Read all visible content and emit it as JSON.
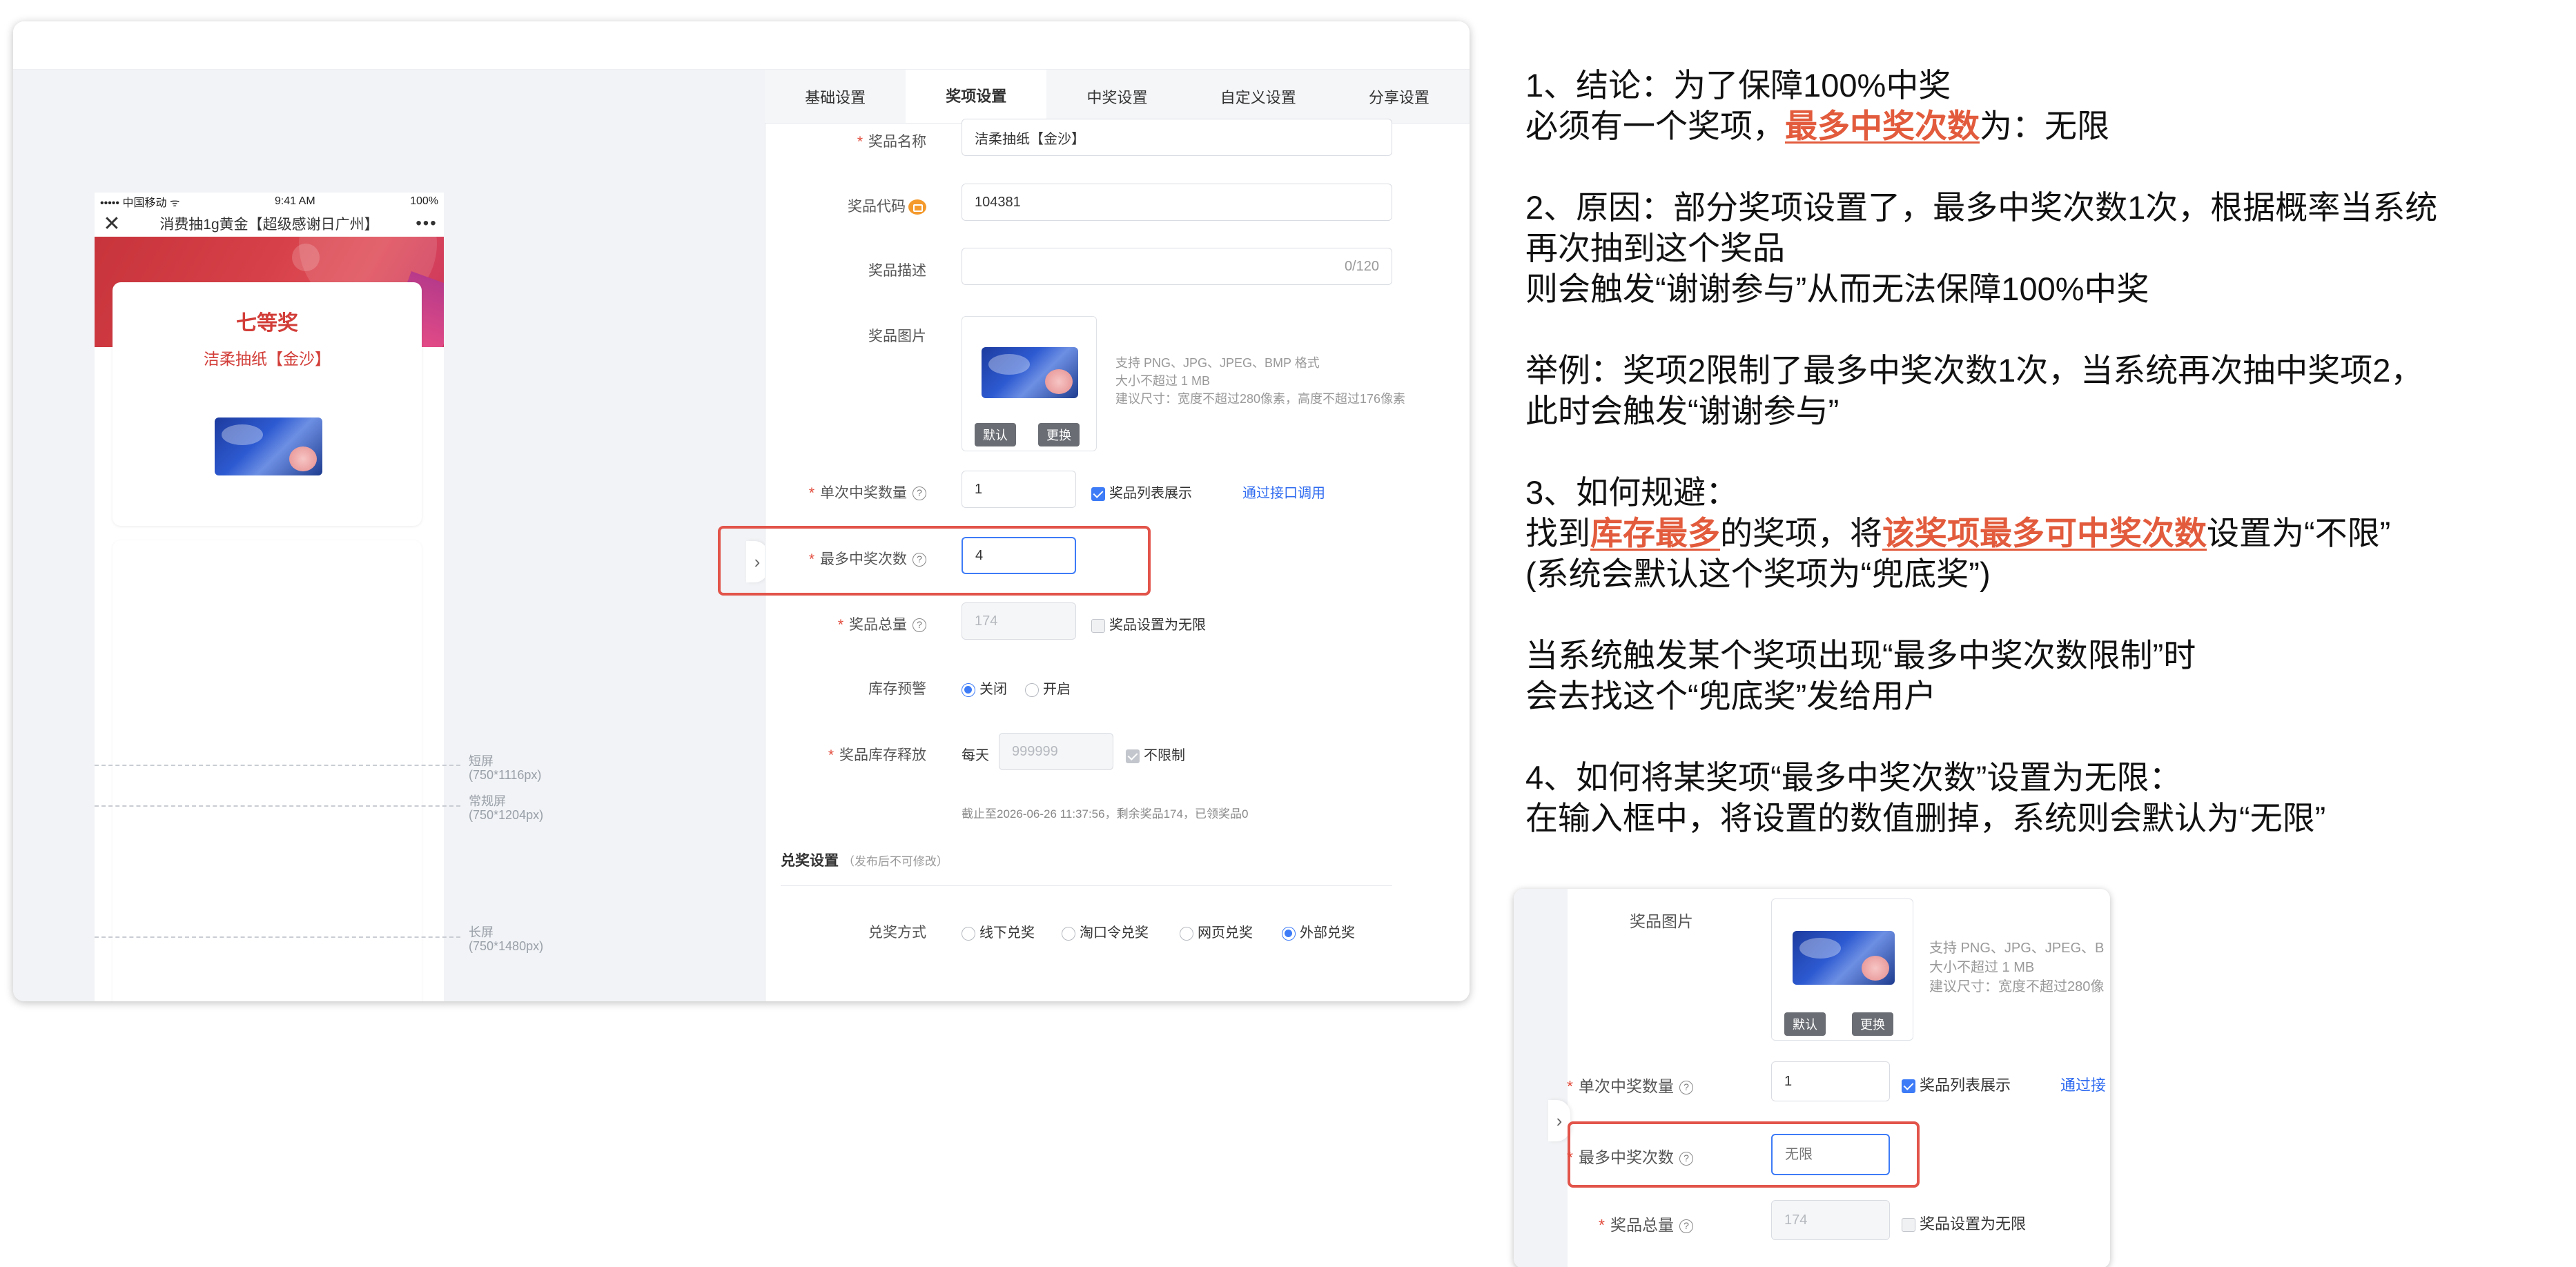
{
  "tabs": [
    "基础设置",
    "奖项设置",
    "中奖设置",
    "自定义设置",
    "分享设置"
  ],
  "phone": {
    "carrier": "••••• 中国移动 ᯤ",
    "time": "9:41 AM",
    "battery": "100%",
    "title": "消费抽1g黄金【超级感谢日广州】",
    "close": "✕",
    "more": "•••",
    "prize_level": "七等奖",
    "prize_name": "洁柔抽纸【金沙】"
  },
  "guides": [
    {
      "label": "短屏",
      "size": "(750*1116px)"
    },
    {
      "label": "常规屏",
      "size": "(750*1204px)"
    },
    {
      "label": "长屏",
      "size": "(750*1480px)"
    }
  ],
  "form": {
    "name_label": "奖品名称",
    "name_value": "洁柔抽纸【金沙】",
    "code_label": "奖品代码",
    "code_value": "104381",
    "desc_label": "奖品描述",
    "desc_count": "0/120",
    "image_label": "奖品图片",
    "image_hint_1": "支持 PNG、JPG、JPEG、BMP 格式",
    "image_hint_2": "大小不超过 1 MB",
    "image_hint_3": "建议尺寸：宽度不超过280像素，高度不超过176像素",
    "btn_default": "默认",
    "btn_replace": "更换",
    "single_label": "单次中奖数量",
    "single_value": "1",
    "show_in_list": "奖品列表展示",
    "api_link": "通过接口调用",
    "max_label": "最多中奖次数",
    "max_value": "4",
    "total_label": "奖品总量",
    "total_value": "174",
    "total_unlimited": "奖品设置为无限",
    "alert_label": "库存预警",
    "alert_off": "关闭",
    "alert_on": "开启",
    "release_label": "奖品库存释放",
    "release_daily": "每天",
    "release_value": "999999",
    "release_unlimited": "不限制",
    "stock_note": "截止至2026-06-26 11:37:56，剩余奖品174，已领奖品0",
    "redeem_section": "兑奖设置",
    "redeem_note": "（发布后不可修改）",
    "redeem_label": "兑奖方式",
    "redeem_options": [
      "线下兑奖",
      "淘口令兑奖",
      "网页兑奖",
      "外部兑奖"
    ]
  },
  "notes": {
    "p1_l1": "1、结论：为了保障100%中奖",
    "p1_l2_a": "必须有一个奖项，",
    "p1_l2_hl": "最多中奖次数",
    "p1_l2_b": "为：无限",
    "p2_l1": "2、原因：部分奖项设置了，最多中奖次数1次，根据概率当系统",
    "p2_l2": "再次抽到这个奖品",
    "p2_l3": "则会触发“谢谢参与”从而无法保障100%中奖",
    "p3_l1": "举例：奖项2限制了最多中奖次数1次，当系统再次抽中奖项2，",
    "p3_l2": "此时会触发“谢谢参与”",
    "p4_l1": "3、如何规避：",
    "p4_l2_a": "找到",
    "p4_l2_hl1": "库存最多",
    "p4_l2_b": "的奖项，将",
    "p4_l2_hl2": "该奖项最多可中奖次数",
    "p4_l2_c": "设置为“不限”",
    "p4_l3": "(系统会默认这个奖项为“兜底奖”)",
    "p5_l1": "当系统触发某个奖项出现“最多中奖次数限制”时",
    "p5_l2": "会去找这个“兜底奖”发给用户",
    "p6_l1": "4、如何将某奖项“最多中奖次数”设置为无限：",
    "p6_l2": "在输入框中，将设置的数值删掉，系统则会默认为“无限”"
  },
  "inset": {
    "image_label": "奖品图片",
    "image_hint_1": "支持 PNG、JPG、JPEG、B",
    "image_hint_2": "大小不超过 1 MB",
    "image_hint_3": "建议尺寸：宽度不超过280像",
    "btn_default": "默认",
    "btn_replace": "更换",
    "single_label": "单次中奖数量",
    "single_value": "1",
    "show_in_list": "奖品列表展示",
    "api_link": "通过接",
    "max_label": "最多中奖次数",
    "max_placeholder": "无限",
    "total_label": "奖品总量",
    "total_value": "174",
    "total_unlimited": "奖品设置为无限"
  }
}
